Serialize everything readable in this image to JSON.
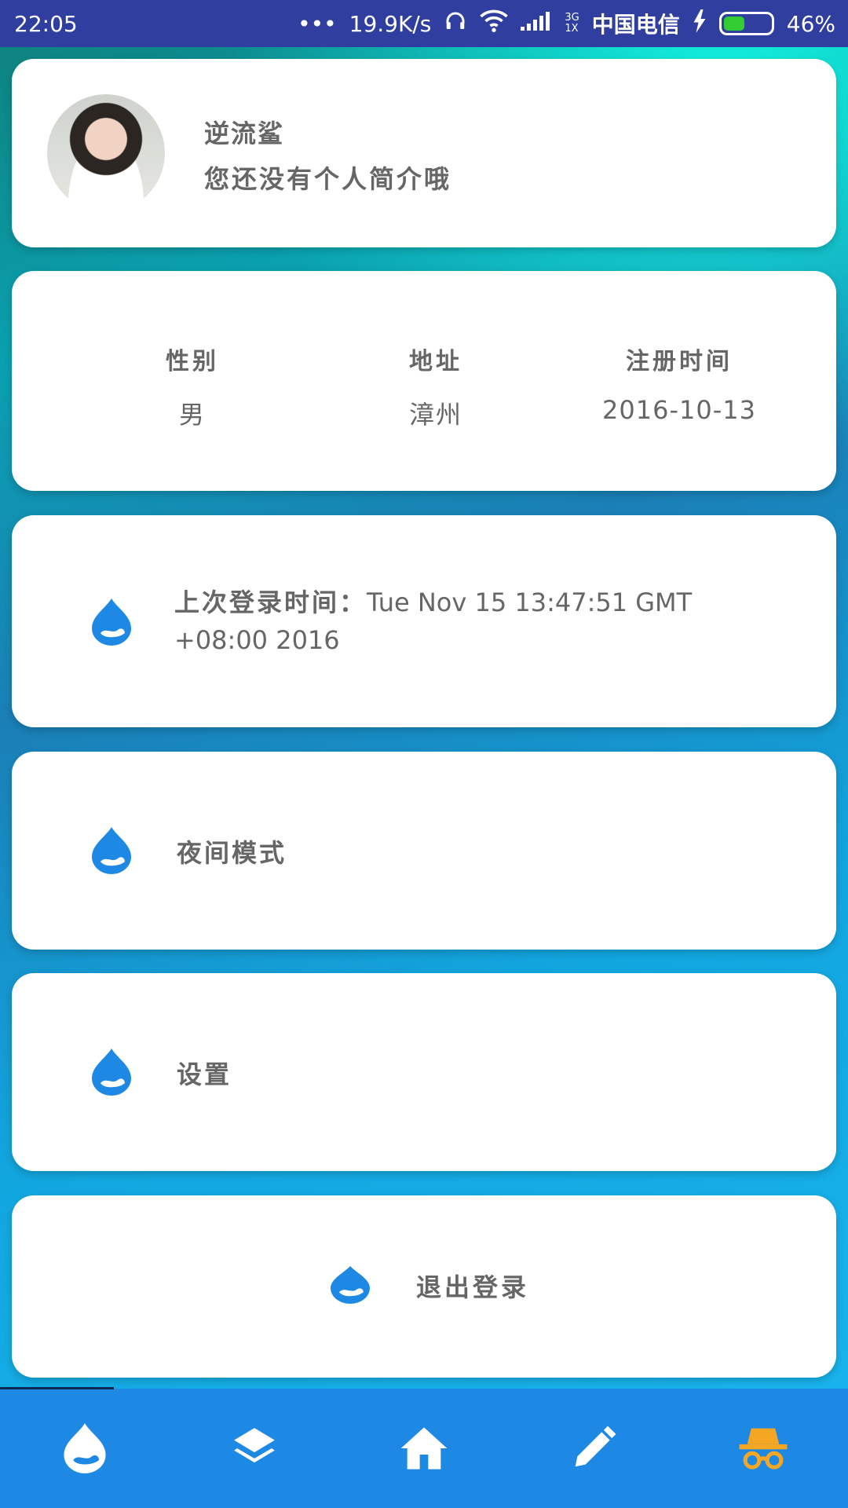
{
  "status_bar": {
    "time": "22:05",
    "dots": "•••",
    "speed": "19.9K/s",
    "network_type": "3G\n1X",
    "carrier": "中国电信",
    "battery_percent": "46%",
    "battery_level": 0.46
  },
  "profile": {
    "name": "逆流鲨",
    "bio": "您还没有个人简介哦"
  },
  "info": {
    "gender_label": "性别",
    "gender_value": "男",
    "address_label": "地址",
    "address_value": "漳州",
    "register_label": "注册时间",
    "register_value": "2016-10-13"
  },
  "login": {
    "label": "上次登录时间：",
    "value": "Tue Nov 15 13:47:51 GMT +08:00 2016"
  },
  "menu": {
    "night_mode": "夜间模式",
    "settings": "设置",
    "logout": "退出登录"
  },
  "nav": {
    "items": [
      "drupal-icon",
      "layers-icon",
      "home-icon",
      "edit-icon",
      "incognito-icon"
    ],
    "active_index": 4
  },
  "colors": {
    "accent": "#1e88e5",
    "status_bar": "#303f9f",
    "active_nav": "#f5a623",
    "text": "#666666"
  }
}
